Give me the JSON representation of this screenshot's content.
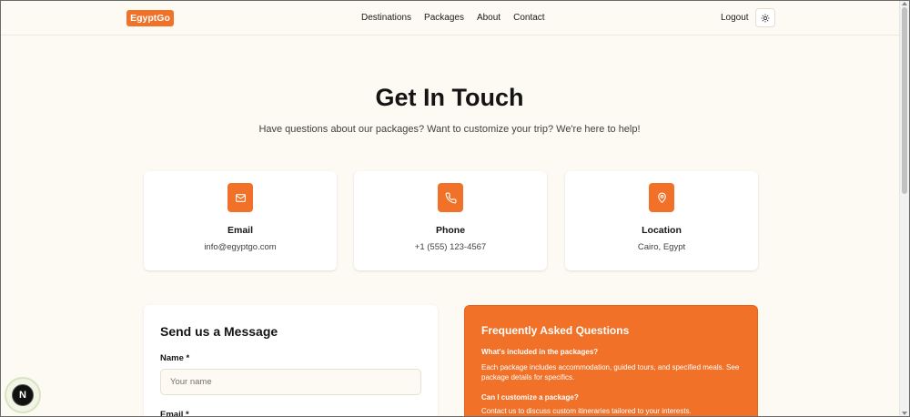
{
  "header": {
    "logo": "EgyptGo",
    "nav": [
      "Destinations",
      "Packages",
      "About",
      "Contact"
    ],
    "logout": "Logout",
    "theme_icon": "sun-icon"
  },
  "hero": {
    "title": "Get In Touch",
    "subtitle": "Have questions about our packages? Want to customize your trip? We're here to help!"
  },
  "contact_cards": [
    {
      "icon": "mail-icon",
      "title": "Email",
      "value": "info@egyptgo.com"
    },
    {
      "icon": "phone-icon",
      "title": "Phone",
      "value": "+1 (555) 123-4567"
    },
    {
      "icon": "map-pin-icon",
      "title": "Location",
      "value": "Cairo, Egypt"
    }
  ],
  "form": {
    "title": "Send us a Message",
    "name_label": "Name *",
    "name_placeholder": "Your name",
    "email_label": "Email *"
  },
  "faq": {
    "title": "Frequently Asked Questions",
    "items": [
      {
        "q": "What's included in the packages?",
        "a": "Each package includes accommodation, guided tours, and specified meals. See package details for specifics."
      },
      {
        "q": "Can I customize a package?",
        "a": "Contact us to discuss custom itineraries tailored to your interests."
      }
    ]
  },
  "floating_badge": {
    "label": "N"
  },
  "colors": {
    "accent": "#f07127",
    "background": "#fdf9f3"
  }
}
